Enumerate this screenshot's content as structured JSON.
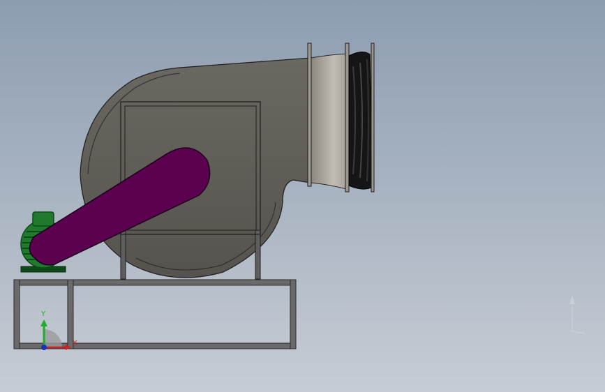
{
  "viewport": {
    "background_top": "#8d9db0",
    "background_bottom": "#c7ccd4"
  },
  "model": {
    "parts": [
      "fan-housing",
      "inlet-flange",
      "pulley",
      "belt-guard",
      "motor",
      "base-frame"
    ],
    "colors": {
      "housing": "#5c5a55",
      "housing_edge": "#1e1e1e",
      "belt_guard": "#5c0050",
      "motor": "#1f7a2e",
      "motor_dark": "#0e4a18",
      "frame": "#606060",
      "pulley": "#111111"
    }
  },
  "triad": {
    "x_label": "X",
    "y_label": "Y",
    "x_color": "#d42020",
    "y_color": "#1fae2c",
    "z_color": "#1a2fbf"
  }
}
